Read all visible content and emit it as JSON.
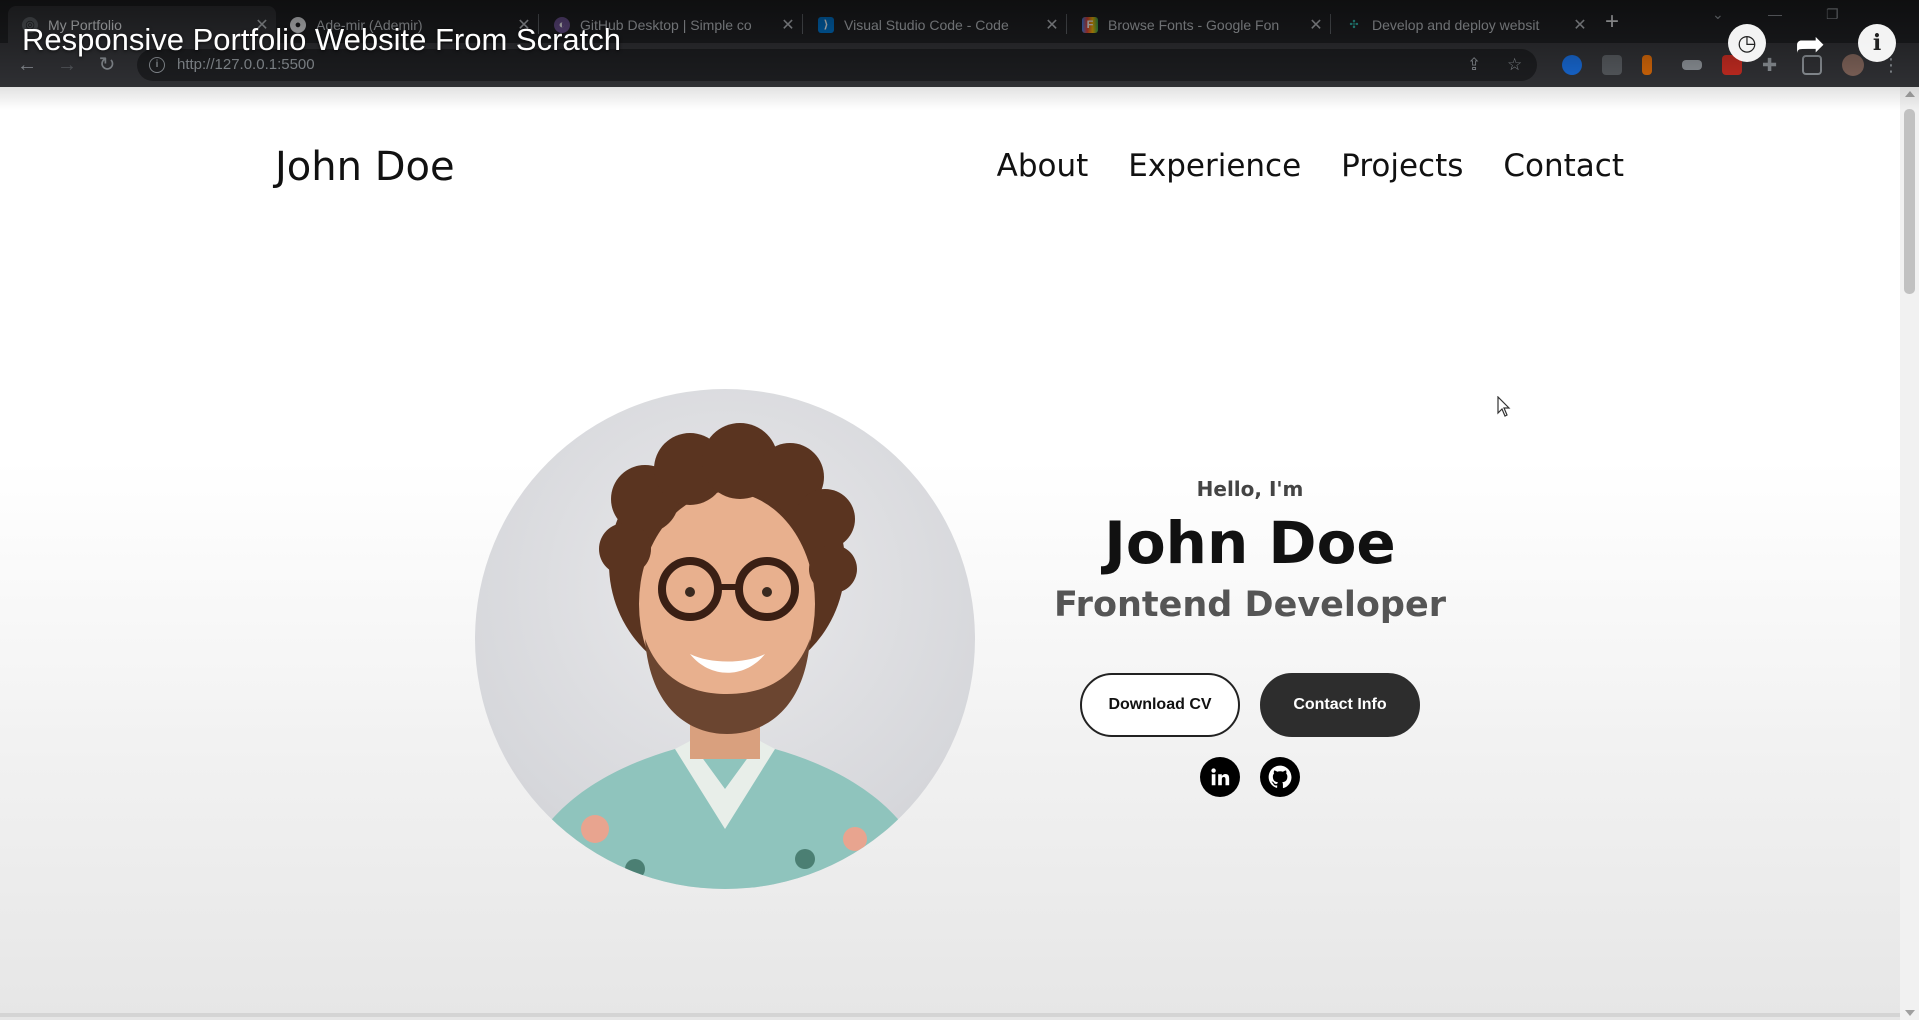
{
  "video": {
    "title": "Responsive Portfolio Website From Scratch"
  },
  "browser": {
    "tabs": [
      {
        "title": "My Portfolio",
        "icon": "globe-icon",
        "active": true
      },
      {
        "title": "Ade-mir (Ademir)",
        "icon": "github-icon",
        "active": false
      },
      {
        "title": "GitHub Desktop | Simple co",
        "icon": "github-desktop-icon",
        "active": false
      },
      {
        "title": "Visual Studio Code - Code",
        "icon": "vscode-icon",
        "active": false
      },
      {
        "title": "Browse Fonts - Google Fon",
        "icon": "google-fonts-icon",
        "active": false
      },
      {
        "title": "Develop and deploy websit",
        "icon": "netlify-icon",
        "active": false
      }
    ],
    "url": "http://127.0.0.1:5500"
  },
  "site": {
    "logo": "John Doe",
    "nav": [
      "About",
      "Experience",
      "Projects",
      "Contact"
    ],
    "hero": {
      "greeting": "Hello, I'm",
      "name": "John Doe",
      "role": "Frontend Developer",
      "download_cv_label": "Download CV",
      "contact_info_label": "Contact Info",
      "social": [
        "linkedin-icon",
        "github-icon"
      ]
    }
  },
  "colors": {
    "chrome_dark": "#202124",
    "toolbar": "#35363a",
    "button_dark": "#2d2d2d",
    "text_dark": "#111111"
  }
}
